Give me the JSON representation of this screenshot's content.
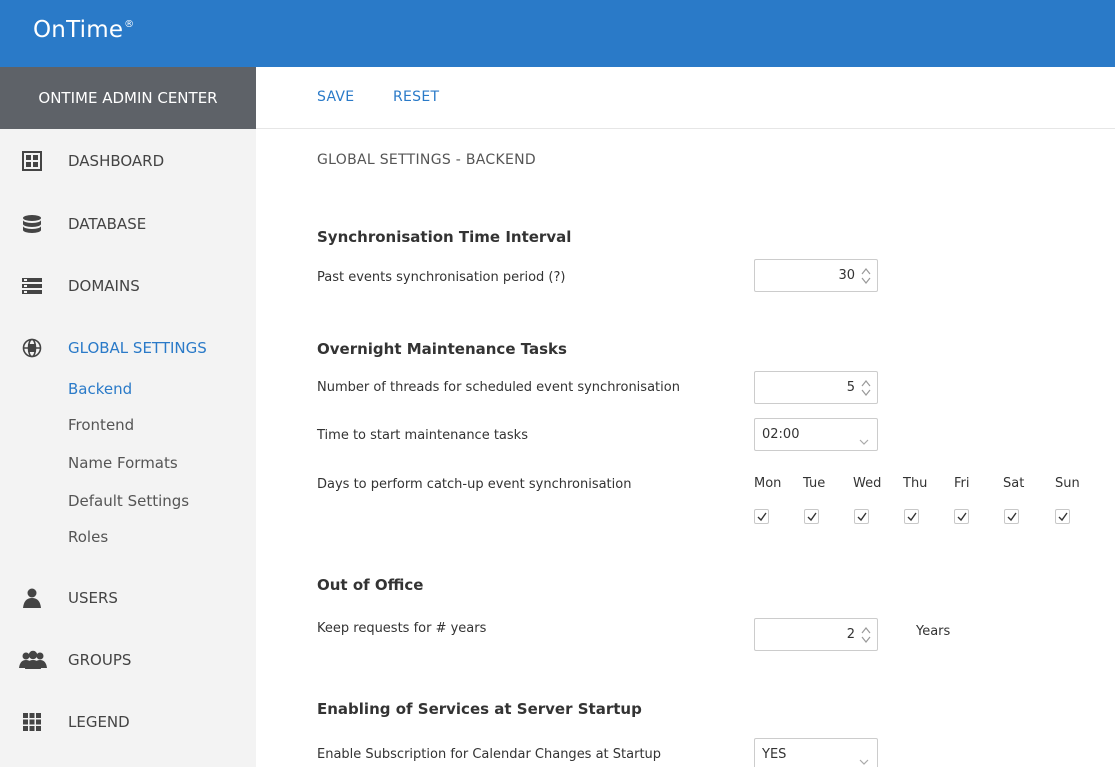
{
  "app": {
    "brand": "OnTime",
    "registered": "®"
  },
  "sidebar": {
    "header": "ONTIME ADMIN CENTER",
    "items": [
      {
        "label": "DASHBOARD",
        "icon": "dashboard-icon"
      },
      {
        "label": "DATABASE",
        "icon": "database-icon"
      },
      {
        "label": "DOMAINS",
        "icon": "domains-icon"
      },
      {
        "label": "GLOBAL SETTINGS",
        "icon": "globe-icon"
      },
      {
        "label": "USERS",
        "icon": "user-icon"
      },
      {
        "label": "GROUPS",
        "icon": "groups-icon"
      },
      {
        "label": "LEGEND",
        "icon": "legend-grid-icon"
      }
    ],
    "sub_items": [
      "Backend",
      "Frontend",
      "Name Formats",
      "Default Settings",
      "Roles"
    ],
    "colors": {
      "active": "#2a7ac8",
      "header_bg": "#5e6268",
      "bg": "#f3f3f3"
    }
  },
  "toolbar": {
    "save_label": "SAVE",
    "reset_label": "RESET"
  },
  "page": {
    "title": "GLOBAL SETTINGS - BACKEND"
  },
  "sections": {
    "sync": {
      "title": "Synchronisation Time Interval",
      "past_events_label": "Past events synchronisation period (?)",
      "past_events_value": "30"
    },
    "overnight": {
      "title": "Overnight Maintenance Tasks",
      "threads_label": "Number of threads for scheduled event synchronisation",
      "threads_value": "5",
      "start_time_label": "Time to start maintenance tasks",
      "start_time_value": "02:00",
      "days_label": "Days to perform catch-up event synchronisation",
      "days": [
        {
          "label": "Mon",
          "checked": true
        },
        {
          "label": "Tue",
          "checked": true
        },
        {
          "label": "Wed",
          "checked": true
        },
        {
          "label": "Thu",
          "checked": true
        },
        {
          "label": "Fri",
          "checked": true
        },
        {
          "label": "Sat",
          "checked": true
        },
        {
          "label": "Sun",
          "checked": true
        }
      ]
    },
    "ooo": {
      "title": "Out of Office",
      "keep_label": "Keep requests for # years",
      "keep_value": "2",
      "unit": "Years"
    },
    "services": {
      "title": "Enabling of Services at Server Startup",
      "subscription_label": "Enable Subscription for Calendar Changes at Startup",
      "subscription_value": "YES"
    }
  },
  "colors": {
    "topbar": "#2a7ac8",
    "accent": "#2a7ac8"
  }
}
